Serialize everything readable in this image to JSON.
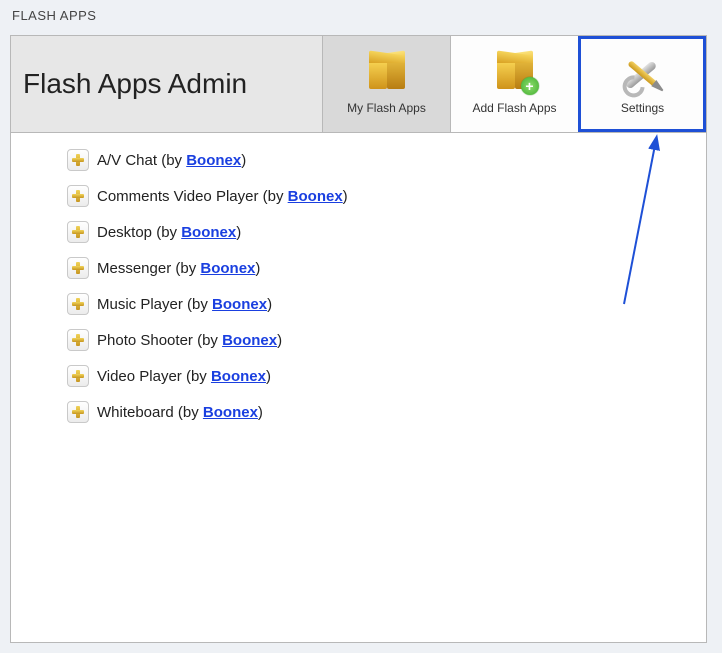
{
  "pageTitle": "FLASH APPS",
  "header": {
    "title": "Flash Apps Admin"
  },
  "tabs": [
    {
      "id": "my",
      "label": "My Flash Apps",
      "icon": "box",
      "active": true,
      "highlight": false
    },
    {
      "id": "add",
      "label": "Add Flash Apps",
      "icon": "box-plus",
      "active": false,
      "highlight": false
    },
    {
      "id": "settings",
      "label": "Settings",
      "icon": "tools",
      "active": false,
      "highlight": true
    }
  ],
  "by_label": "by",
  "apps": [
    {
      "name": "A/V Chat",
      "vendor": "Boonex"
    },
    {
      "name": "Comments Video Player",
      "vendor": "Boonex"
    },
    {
      "name": "Desktop",
      "vendor": "Boonex"
    },
    {
      "name": "Messenger",
      "vendor": "Boonex"
    },
    {
      "name": "Music Player",
      "vendor": "Boonex"
    },
    {
      "name": "Photo Shooter",
      "vendor": "Boonex"
    },
    {
      "name": "Video Player",
      "vendor": "Boonex"
    },
    {
      "name": "Whiteboard",
      "vendor": "Boonex"
    }
  ],
  "colors": {
    "highlight": "#1e50d6",
    "link": "#1a3fe0"
  }
}
